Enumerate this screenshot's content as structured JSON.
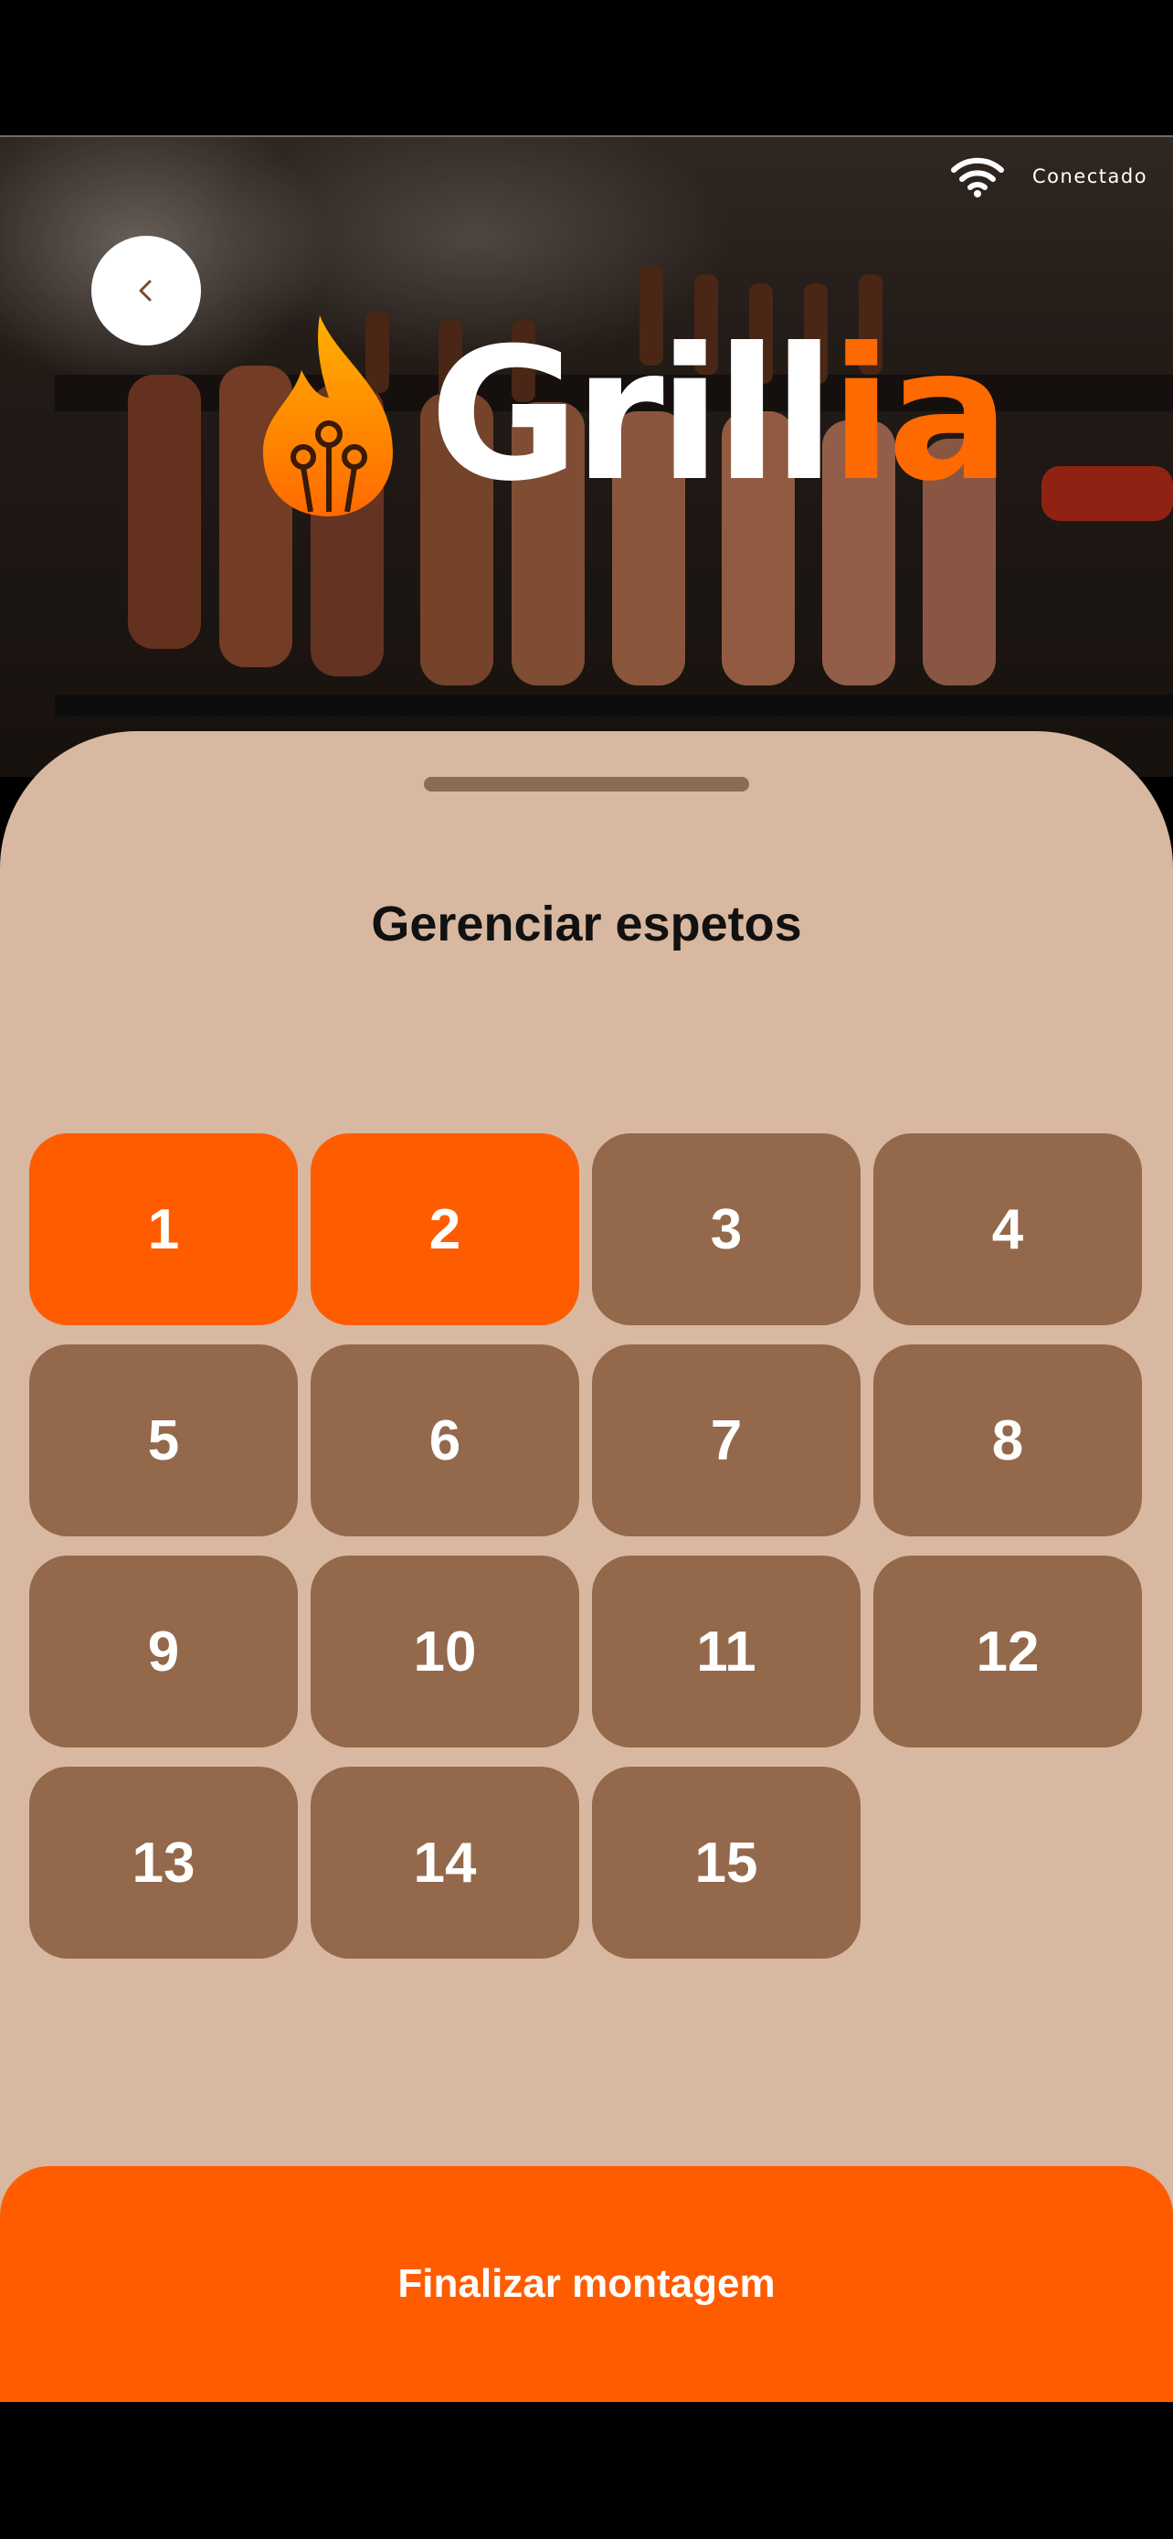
{
  "status": {
    "connection_label": "Conectado",
    "connection_icon": "wifi-icon"
  },
  "header": {
    "back_icon": "chevron-left-icon",
    "logo": {
      "part1": "Grill",
      "part2": "ia"
    }
  },
  "sheet": {
    "title": "Gerenciar espetos",
    "skewers": [
      {
        "label": "1",
        "selected": true
      },
      {
        "label": "2",
        "selected": true
      },
      {
        "label": "3",
        "selected": false
      },
      {
        "label": "4",
        "selected": false
      },
      {
        "label": "5",
        "selected": false
      },
      {
        "label": "6",
        "selected": false
      },
      {
        "label": "7",
        "selected": false
      },
      {
        "label": "8",
        "selected": false
      },
      {
        "label": "9",
        "selected": false
      },
      {
        "label": "10",
        "selected": false
      },
      {
        "label": "11",
        "selected": false
      },
      {
        "label": "12",
        "selected": false
      },
      {
        "label": "13",
        "selected": false
      },
      {
        "label": "14",
        "selected": false
      },
      {
        "label": "15",
        "selected": false
      }
    ]
  },
  "actions": {
    "finish_label": "Finalizar montagem"
  },
  "colors": {
    "accent": "#ff5c00",
    "skewer_default": "#93684b",
    "sheet_background": "#d8b8a0",
    "handle": "#8b6a58"
  }
}
